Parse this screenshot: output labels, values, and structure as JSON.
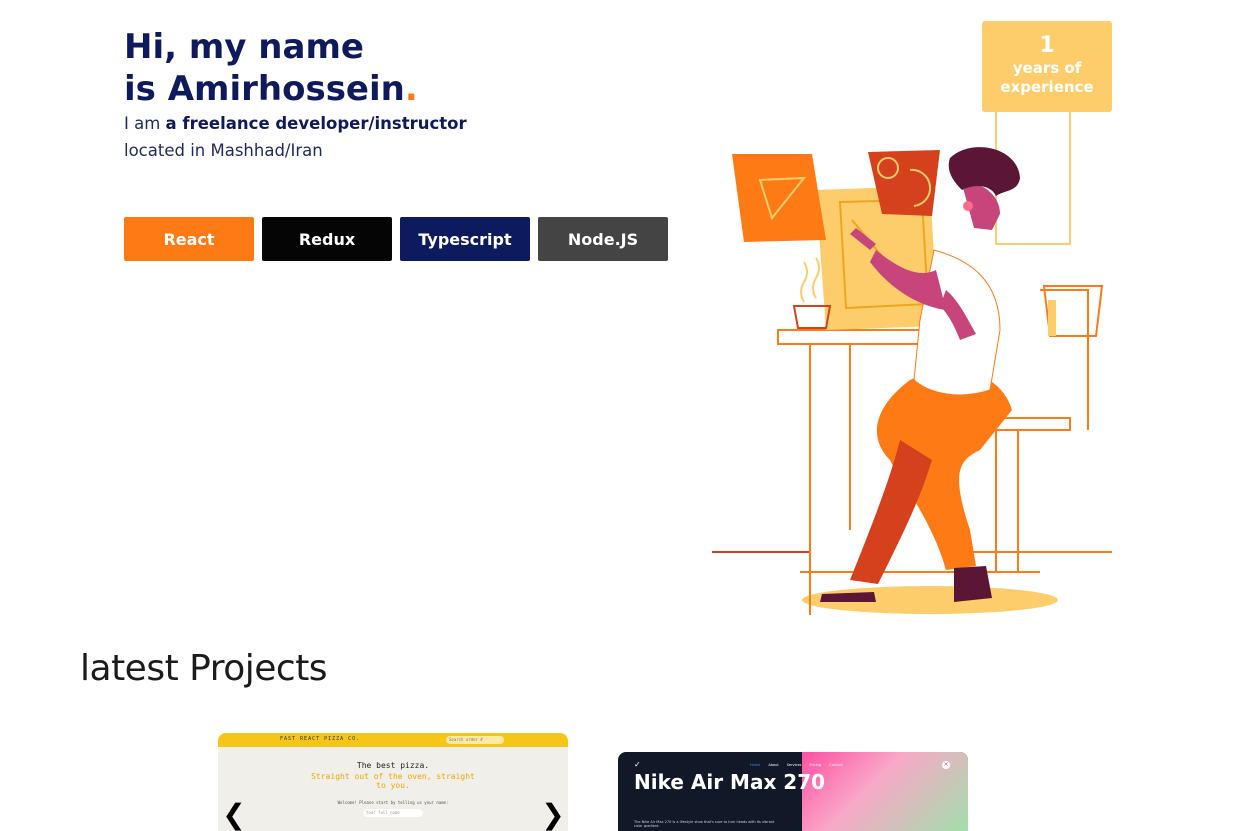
{
  "hero": {
    "title_line1": "Hi, my name",
    "title_line2": "is Amirhossein",
    "title_dot": ".",
    "intro_prefix": "I am ",
    "intro_role": "a freelance developer/instructor",
    "location": "located in Mashhad/Iran"
  },
  "skills": [
    "React",
    "Redux",
    "Typescript",
    "Node.JS"
  ],
  "experience": {
    "years": "1",
    "label": "years of experience"
  },
  "illustration": {
    "icon": "developer-at-desk-illustration"
  },
  "projects": {
    "title": "latest Projects",
    "items": [
      {
        "brand": "FAST REACT PIZZA CO.",
        "search_placeholder": "Search order #",
        "headline": "The best pizza.",
        "subheadline": "Straight out of the oven, straight to you.",
        "note": "Welcome! Please start by telling us your name:",
        "input_placeholder": "Your full name"
      },
      {
        "nav": [
          "Home",
          "About",
          "Services",
          "Pricing",
          "Contact"
        ],
        "title": "Nike Air Max 270",
        "description": "The Nike Air Max 270 is a lifestyle shoe that's sure to turn heads with its vibrant color gradient."
      }
    ]
  },
  "colors": {
    "navy": "#0f1a5c",
    "orange": "#fe7a15",
    "yellow": "#fdcd6c"
  }
}
